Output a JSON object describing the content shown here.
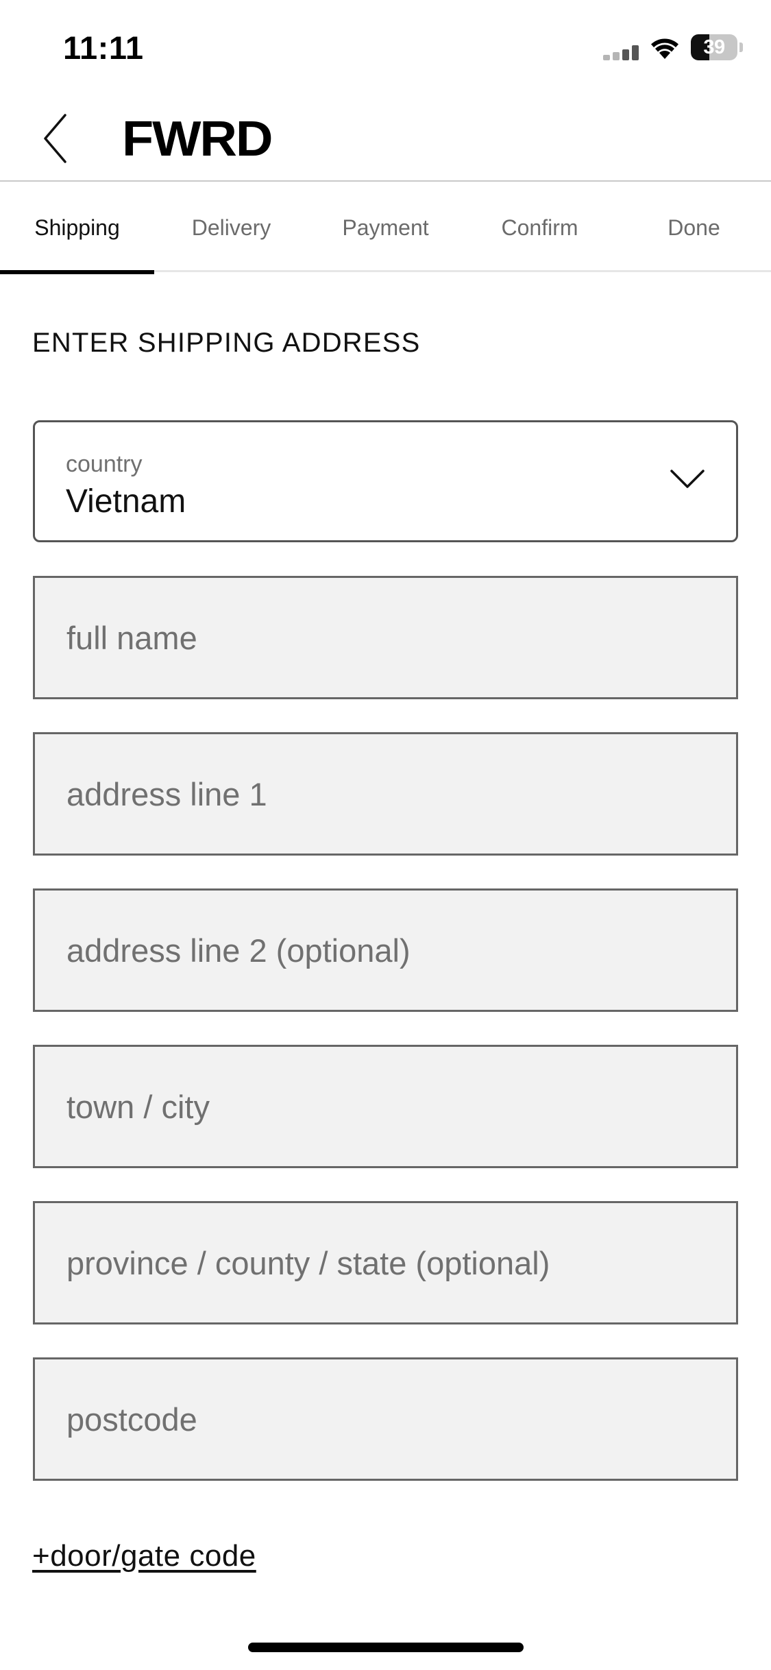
{
  "status_bar": {
    "time": "11:11",
    "battery_level": "39",
    "battery_fraction": 0.39
  },
  "header": {
    "brand": "FWRD",
    "back_icon": "chevron-left-icon"
  },
  "tabs": [
    {
      "label": "Shipping",
      "active": true
    },
    {
      "label": "Delivery",
      "active": false
    },
    {
      "label": "Payment",
      "active": false
    },
    {
      "label": "Confirm",
      "active": false
    },
    {
      "label": "Done",
      "active": false
    }
  ],
  "form": {
    "title": "ENTER SHIPPING ADDRESS",
    "country": {
      "label": "country",
      "value": "Vietnam",
      "icon": "chevron-down-icon"
    },
    "fields": {
      "full_name": {
        "placeholder": "full name",
        "value": ""
      },
      "address_line_1": {
        "placeholder": "address line 1",
        "value": ""
      },
      "address_line_2": {
        "placeholder": "address line 2 (optional)",
        "value": ""
      },
      "town_city": {
        "placeholder": "town / city",
        "value": ""
      },
      "province": {
        "placeholder": "province / county / state (optional)",
        "value": ""
      },
      "postcode": {
        "placeholder": "postcode",
        "value": ""
      }
    },
    "door_gate_link": "+door/gate code"
  },
  "colors": {
    "accent": "#000000",
    "field_background": "#f2f2f2",
    "field_border": "#666666",
    "placeholder_text": "#707070",
    "inactive_tab_text": "#6b6b6b"
  }
}
